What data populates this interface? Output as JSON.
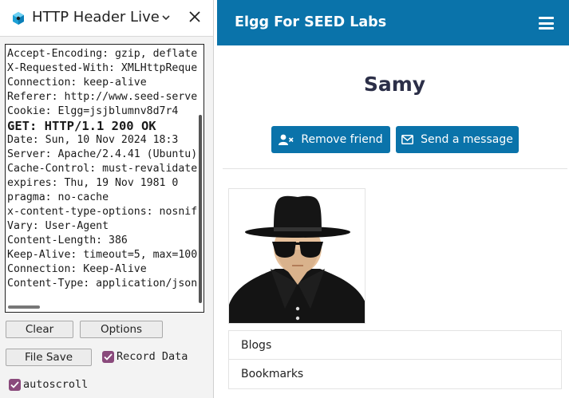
{
  "panel": {
    "title": "HTTP Header Live",
    "log_lines": [
      {
        "text": "Accept-Encoding: gzip, deflate",
        "bold": false
      },
      {
        "text": "X-Requested-With: XMLHttpRequest",
        "bold": false
      },
      {
        "text": "Connection: keep-alive",
        "bold": false
      },
      {
        "text": "Referer: http://www.seed-server.com",
        "bold": false
      },
      {
        "text": "Cookie: Elgg=jsjblumnv8d7r4",
        "bold": false
      },
      {
        "text": "GET: HTTP/1.1 200 OK",
        "bold": true
      },
      {
        "text": "Date: Sun, 10 Nov 2024 18:3",
        "bold": false
      },
      {
        "text": "Server: Apache/2.4.41 (Ubuntu)",
        "bold": false
      },
      {
        "text": "Cache-Control: must-revalidate",
        "bold": false
      },
      {
        "text": "expires: Thu, 19 Nov 1981 0",
        "bold": false
      },
      {
        "text": "pragma: no-cache",
        "bold": false
      },
      {
        "text": "x-content-type-options: nosniff",
        "bold": false
      },
      {
        "text": "Vary: User-Agent",
        "bold": false
      },
      {
        "text": "Content-Length: 386",
        "bold": false
      },
      {
        "text": "Keep-Alive: timeout=5, max=100",
        "bold": false
      },
      {
        "text": "Connection: Keep-Alive",
        "bold": false
      },
      {
        "text": "Content-Type: application/json",
        "bold": false
      }
    ],
    "buttons": {
      "clear": "Clear",
      "options": "Options",
      "file_save": "File Save"
    },
    "checkboxes": {
      "record_data": "Record Data",
      "autoscroll": "autoscroll"
    }
  },
  "site": {
    "brand": "Elgg For SEED Labs",
    "profile_name": "Samy",
    "remove_friend": "Remove friend",
    "send_message": "Send a message",
    "menu": [
      "Blogs",
      "Bookmarks"
    ]
  },
  "colors": {
    "topbar": "#0a73aa",
    "checkbox": "#8a4a7c"
  }
}
